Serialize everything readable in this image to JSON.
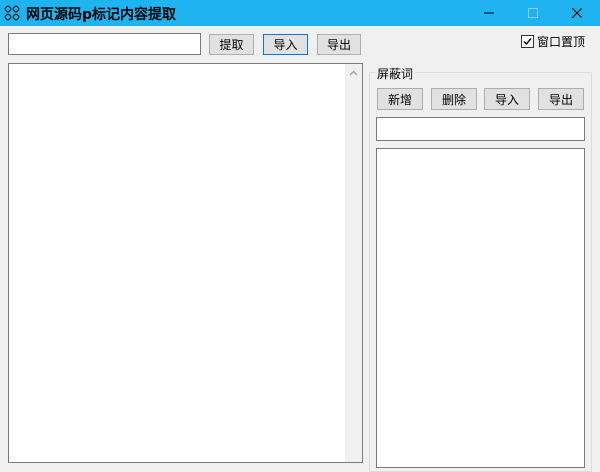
{
  "window": {
    "title": "网页源码p标记内容提取",
    "accent_color": "#1fb3f0",
    "app_icon": "grid-app-icon"
  },
  "toolbar": {
    "url_value": "",
    "extract_label": "提取",
    "import_label": "导入",
    "export_label": "导出"
  },
  "options": {
    "always_on_top_label": "窗口置顶",
    "always_on_top_checked": true
  },
  "content": {
    "text": ""
  },
  "blocked_words": {
    "group_label": "屏蔽词",
    "add_label": "新增",
    "delete_label": "删除",
    "import_label": "导入",
    "export_label": "导出",
    "input_value": "",
    "items": []
  }
}
